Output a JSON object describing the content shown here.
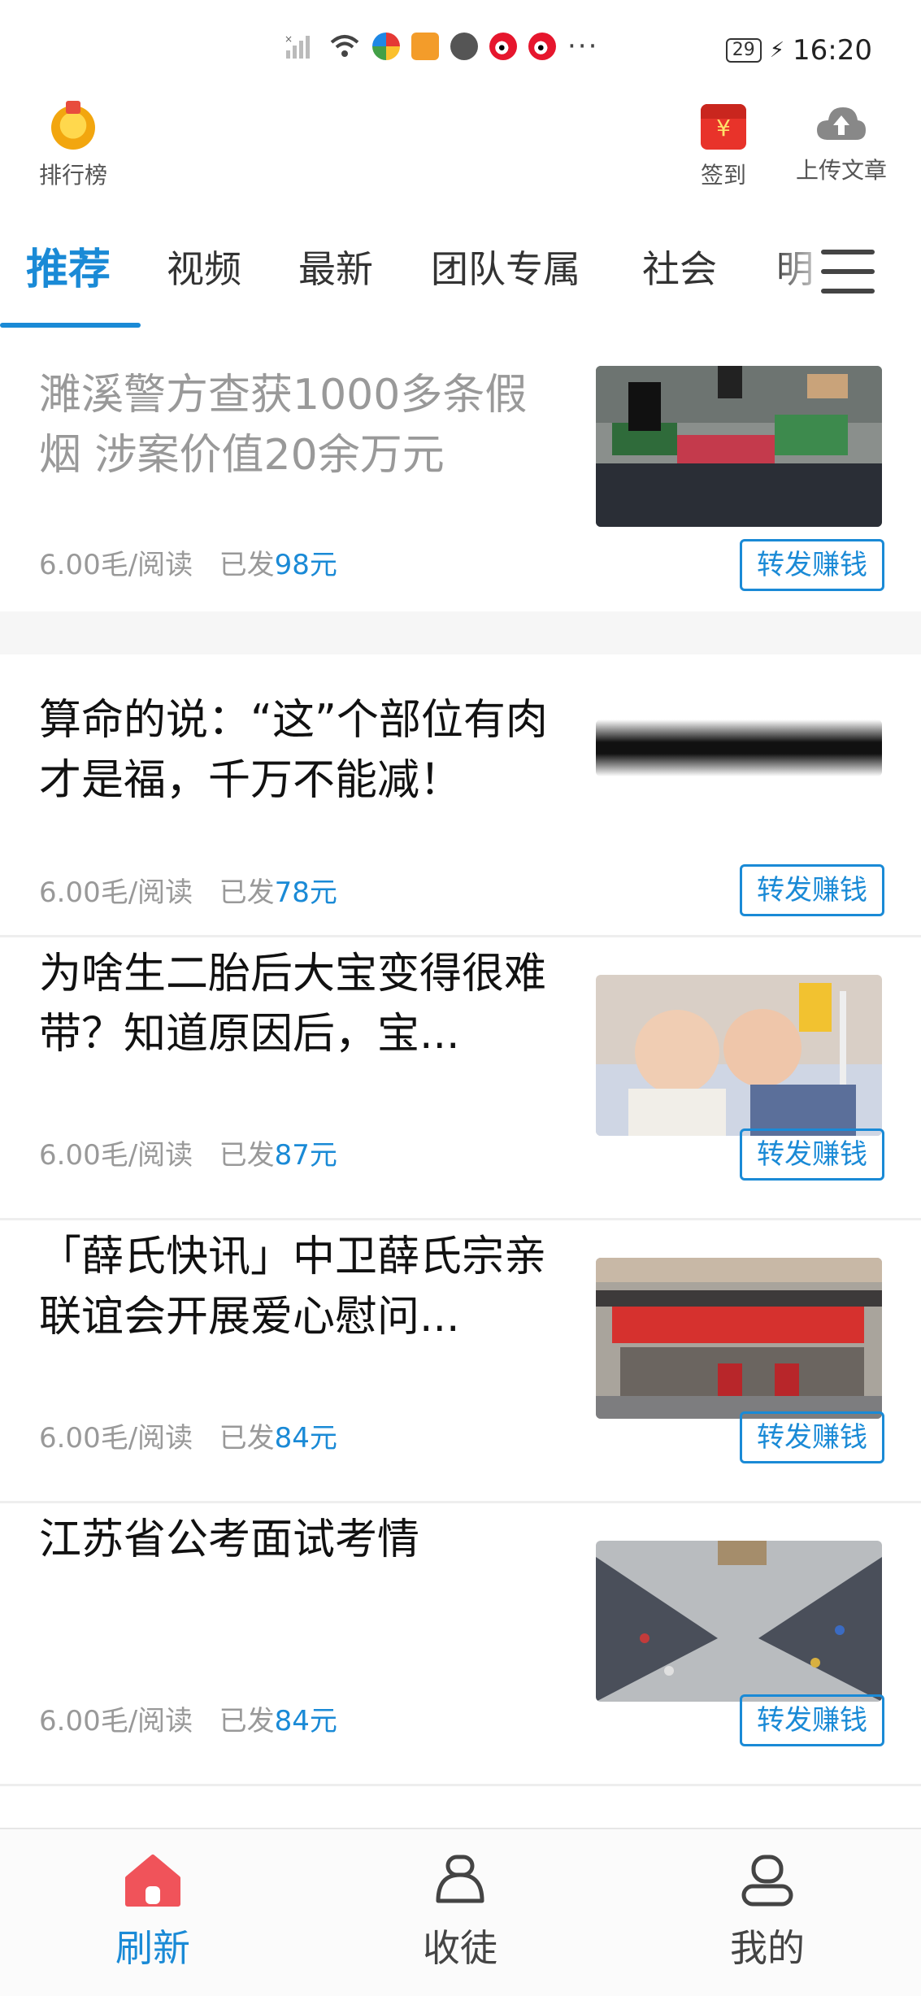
{
  "status_bar": {
    "battery": "29",
    "time": "16:20",
    "dots": "···"
  },
  "header": {
    "ranking_label": "排行榜",
    "signin_label": "签到",
    "signin_symbol": "¥",
    "upload_label": "上传文章"
  },
  "tabs": [
    {
      "label": "推荐",
      "active": true
    },
    {
      "label": "视频"
    },
    {
      "label": "最新"
    },
    {
      "label": "团队专属"
    },
    {
      "label": "社会"
    },
    {
      "label": "明"
    }
  ],
  "feed": [
    {
      "title": "濉溪警方查获1000多条假烟 涉案价值20余万元",
      "rate": "6.00毛/阅读",
      "sent_prefix": "已发",
      "sent_amount": "98元",
      "share": "转发赚钱",
      "read": true
    },
    {
      "title": "算命的说：“这”个部位有肉才是福，千万不能减！",
      "rate": "6.00毛/阅读",
      "sent_prefix": "已发",
      "sent_amount": "78元",
      "share": "转发赚钱"
    },
    {
      "title": "为啥生二胎后大宝变得很难带？知道原因后，宝...",
      "rate": "6.00毛/阅读",
      "sent_prefix": "已发",
      "sent_amount": "87元",
      "share": "转发赚钱"
    },
    {
      "title": "「薛氏快讯」中卫薛氏宗亲联谊会开展爱心慰问...",
      "rate": "6.00毛/阅读",
      "sent_prefix": "已发",
      "sent_amount": "84元",
      "share": "转发赚钱"
    },
    {
      "title": "江苏省公考面试考情",
      "rate": "6.00毛/阅读",
      "sent_prefix": "已发",
      "sent_amount": "84元",
      "share": "转发赚钱"
    }
  ],
  "bottom_nav": [
    {
      "label": "刷新",
      "icon": "home-icon",
      "active": true
    },
    {
      "label": "收徒",
      "icon": "apprentice-icon"
    },
    {
      "label": "我的",
      "icon": "profile-icon"
    }
  ],
  "colors": {
    "accent": "#1a8ad6",
    "home_icon": "#f0535a"
  }
}
